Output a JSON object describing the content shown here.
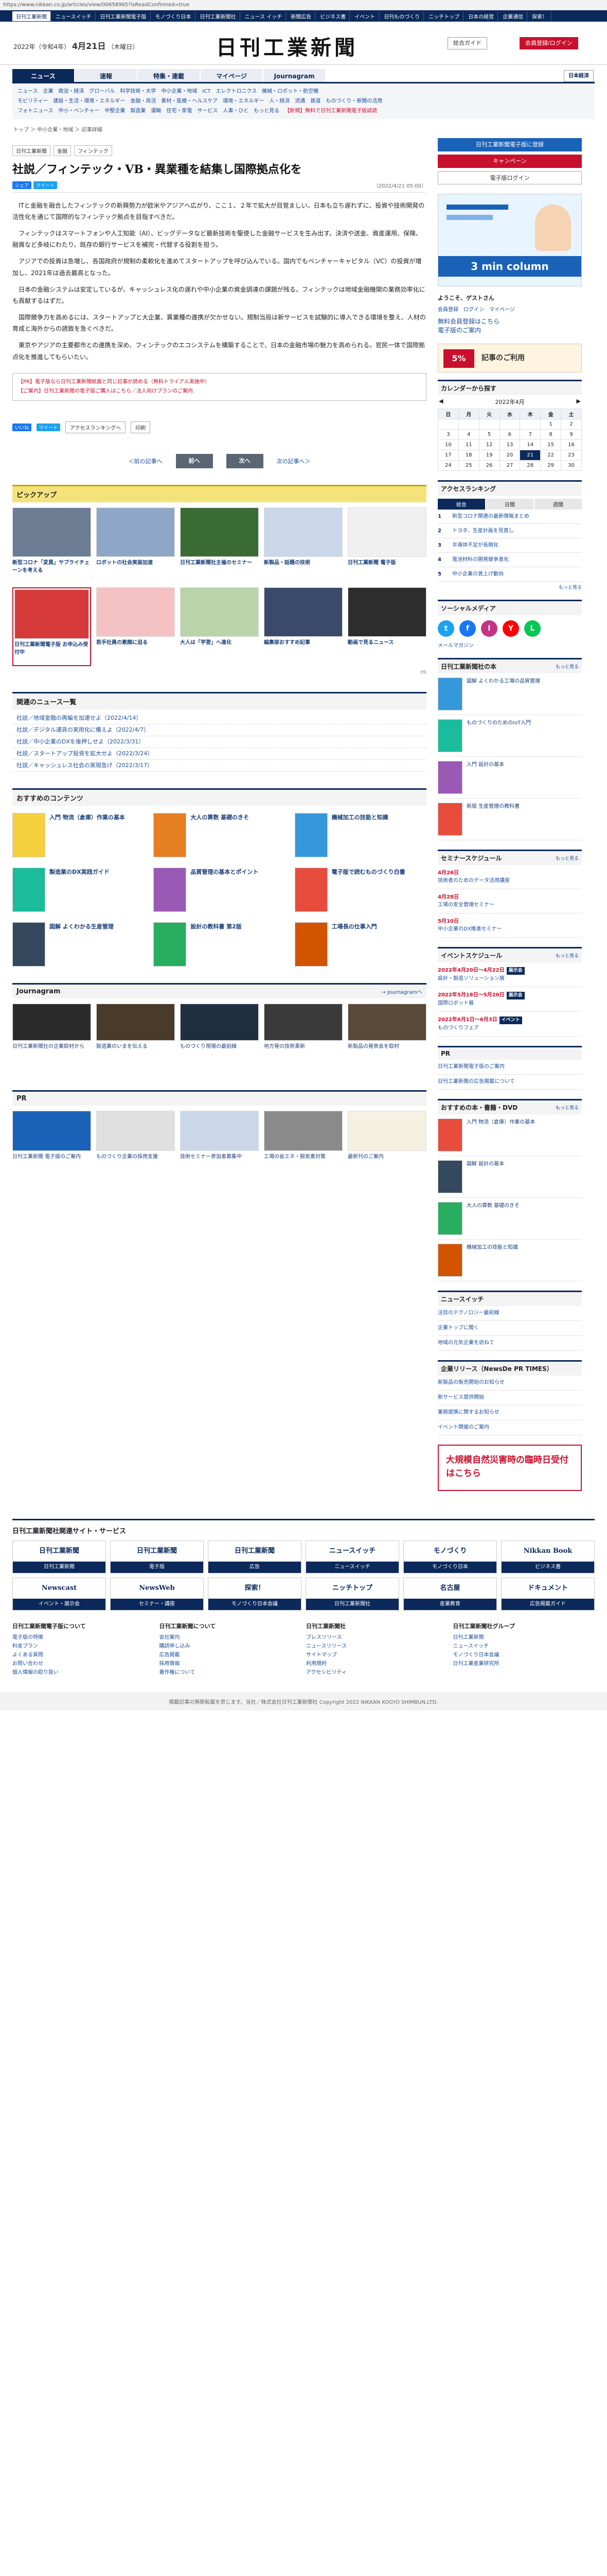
{
  "url": "https://www.nikkan.co.jp/articles/view/00658965?isReadConfirmed=true",
  "topbar": [
    "日刊工業新聞",
    "ニュースイッチ",
    "日刊工業新聞電子版",
    "モノづくり日本",
    "日刊工業新聞社",
    "ニュース イッチ",
    "新聞広告",
    "ビジネス書",
    "イベント",
    "日刊ものづくり",
    "ニッチトップ",
    "日本の経営",
    "企業通信",
    "探索！"
  ],
  "masthead": {
    "date": "2022年（令和4年）",
    "date_md": "4月21日",
    "weekday": "（木曜日）",
    "logo": "日刊工業新聞",
    "guide": "総合ガイド",
    "signup": "会員登録/ログイン"
  },
  "nav": {
    "tabs": [
      "ニュース",
      "速報",
      "特集・連載",
      "マイページ",
      "Journagram"
    ],
    "login": "日本経済"
  },
  "subnav": {
    "rows": [
      [
        "ニュース",
        "企業",
        "政治・経済",
        "グローバル",
        "科学技術・大学",
        "中小企業・地域",
        "ICT",
        "エレクトロニクス",
        "機械・ロボット・航空機"
      ],
      [
        "モビリティー",
        "建設・生活・環境・エネルギー",
        "金融・商況",
        "素材・医療・ヘルスケア",
        "環境・エネルギー",
        "人・経済",
        "流通",
        "鉄道",
        "ものづくり・新聞の活用"
      ],
      [
        "フォトニュース",
        "中小・ベンチャー",
        "中堅企業",
        "製造業",
        "運輸",
        "住宅・家電",
        "サービス",
        "人事・ひと",
        "もっと見る"
      ]
    ],
    "campaign": "【新規】無料で日刊工業新聞電子版試読"
  },
  "breadcrumb": "トップ ＞ 中小企業・地域 ＞ 記事詳細",
  "article": {
    "tags": [
      "日刊工業新聞",
      "金融",
      "フィンテック"
    ],
    "title": "社説／フィンテック・VB・異業種を結集し国際拠点化を",
    "date": "（2022/4/21 05:00）",
    "share": [
      "シェア",
      "ツイート"
    ],
    "body": [
      "ITと金融を融合したフィンテックの新興勢力が欧米やアジアへ広がり、ここ１、２年で拡大が目覚ましい。日本も立ち遅れずに、投資や技術開発の活性化を通じて国際的なフィンテック拠点を目指すべきだ。",
      "フィンテックはスマートフォンや人工知能（AI）、ビッグデータなど最新技術を駆使した金融サービスを生み出す。決済や送金、資産運用、保険、融資など多岐にわたり、既存の銀行サービスを補完・代替する役割を担う。",
      "アジアでの投資は急増し、各国政府が規制の柔軟化を進めてスタートアップを呼び込んでいる。国内でもベンチャーキャピタル（VC）の投資が増加し、2021年は過去最高となった。",
      "日本の金融システムは安定しているが、キャッシュレス化の遅れや中小企業の資金調達の課題が残る。フィンテックは地域金融機関の業務効率化にも貢献するはずだ。",
      "国際競争力を高めるには、スタートアップと大企業、異業種の連携が欠かせない。規制当局は新サービスを試験的に導入できる環境を整え、人材の育成と海外からの誘致を急ぐべきだ。",
      "東京やアジアの主要都市との連携を深め、フィンテックのエコシステムを構築することで、日本の金融市場の魅力を高められる。官民一体で国際拠点化を推進してもらいたい。"
    ],
    "promo": [
      "【PR】電子版なら日刊工業新聞紙面と同じ記事が読める（無料トライアル実施中）",
      "【ご案内】日刊工業新聞の電子版ご購入はこちら／法人向けプランのご案内"
    ],
    "share_actions": [
      "いいね",
      "ツイート",
      "アクセスランキングへ",
      "印刷"
    ]
  },
  "pager": {
    "prev_text": "＜前の記事へ",
    "prev": "前へ",
    "next": "次へ",
    "next_text": "次の記事へ＞"
  },
  "pickup": {
    "title": "ピックアップ",
    "items": [
      "新型コロナ「変異」サプライチェーンを考える",
      "ロボットの社会実装加速",
      "日刊工業新聞社主催のセミナー",
      "新製品・話題の技術",
      "日刊工業新聞 電子版",
      "日刊工業新聞電子版 お申込み受付中",
      "若手社員の素顔に迫る",
      "大人は「学習」へ進化",
      "編集部おすすめ記事",
      "動画で見るニュース"
    ],
    "pr": "PR"
  },
  "news_list": {
    "title": "関連のニュース一覧",
    "items": [
      "社説／地域金融の再編を加速せよ（2022/4/14）",
      "社説／デジタル通貨の実用化に備えよ（2022/4/7）",
      "社説／中小企業のDXを後押しせよ（2022/3/31）",
      "社説／スタートアップ投資を拡大せよ（2022/3/24）",
      "社説／キャッシュレス社会の実現急げ（2022/3/17）"
    ]
  },
  "recommend": {
    "title": "おすすめのコンテンツ",
    "items": [
      "入門 物流（倉庫）作業の基本",
      "大人の算数 基礎のきそ",
      "機械加工の技能と知識",
      "製造業のDX実践ガイド",
      "品質管理の基本とポイント",
      "電子版で読むものづくり白書",
      "図解 よくわかる生産管理",
      "設計の教科書 第2版",
      "工場長の仕事入門"
    ]
  },
  "journagram": {
    "title": "Journagram",
    "more": "→ Journagramへ",
    "items": [
      "日刊工業新聞社の企業取材から",
      "製造業のいまを伝える",
      "ものづくり現場の最前線",
      "地方発の技術革新",
      "新製品の発表会を取材"
    ]
  },
  "pr_section": {
    "title": "PR",
    "items": [
      "日刊工業新聞 電子版のご案内",
      "ものづくり企業の採用支援",
      "技術セミナー参加者募集中",
      "工場の省エネ・脱炭素対策",
      "最新刊のご案内"
    ]
  },
  "sidebar": {
    "buttons": [
      "日刊工業新聞電子版に登録",
      "キャンペーン",
      "電子版ログイン"
    ],
    "ad_title": "3 min column",
    "welcome": "ようこそ、ゲストさん",
    "welcome_links": [
      "会員登録",
      "ログイン",
      "マイページ"
    ],
    "notices": [
      "無料会員登録はこちら",
      "電子版のご案内"
    ],
    "paper_ad": "記事のご利用",
    "calendar": {
      "title": "カレンダーから探す",
      "month": "2022年4月",
      "weekdays": [
        "日",
        "月",
        "火",
        "水",
        "木",
        "金",
        "土"
      ],
      "weeks": [
        [
          "",
          "",
          "",
          "",
          "",
          "1",
          "2"
        ],
        [
          "3",
          "4",
          "5",
          "6",
          "7",
          "8",
          "9"
        ],
        [
          "10",
          "11",
          "12",
          "13",
          "14",
          "15",
          "16"
        ],
        [
          "17",
          "18",
          "19",
          "20",
          "21",
          "22",
          "23"
        ],
        [
          "24",
          "25",
          "26",
          "27",
          "28",
          "29",
          "30"
        ]
      ]
    },
    "ranking": {
      "title": "アクセスランキング",
      "tabs": [
        "総合",
        "日間",
        "週間"
      ],
      "items": [
        "新型コロナ関連の最新情報まとめ",
        "トヨタ、生産計画を見直し",
        "半導体不足が長期化",
        "電池材料の開発競争激化",
        "中小企業の賃上げ動向"
      ]
    },
    "ranking_more": "もっと見る",
    "social_title": "ソーシャルメディア",
    "social": [
      "t",
      "f",
      "I",
      "Y",
      "L"
    ],
    "mail": "メールマガジン",
    "books": {
      "title": "日刊工業新聞社の本",
      "items": [
        "図解 よくわかる工場の品質管理",
        "ものづくりのためのIoT入門",
        "入門 設計の基本",
        "新版 生産管理の教科書"
      ],
      "more": "もっと見る"
    },
    "seminar": {
      "title": "セミナースケジュール",
      "items": [
        {
          "d": "4月26日",
          "t": "技術者のためのデータ活用講座"
        },
        {
          "d": "4月28日",
          "t": "工場の安全管理セミナー"
        },
        {
          "d": "5月10日",
          "t": "中小企業のDX推進セミナー"
        }
      ],
      "more": "もっと見る"
    },
    "events": {
      "title": "イベントスケジュール",
      "items": [
        {
          "d": "2022年4月20日〜4月22日",
          "t": "設計・製造ソリューション展",
          "k": "展示会"
        },
        {
          "d": "2022年5月18日〜5月20日",
          "t": "国際ロボット展",
          "k": "展示会"
        },
        {
          "d": "2022年6月1日〜6月3日",
          "t": "ものづくりフェア",
          "k": "イベント"
        }
      ],
      "more": "もっと見る"
    },
    "pr_title": "PR",
    "pr_items": [
      "日刊工業新聞電子版のご案内",
      "日刊工業新聞の広告掲載について"
    ],
    "bestseller": {
      "title": "おすすめの本・書籍・DVD",
      "items": [
        "入門 物流（倉庫）作業の基本",
        "図解 設計の基本",
        "大人の算数 基礎のきそ",
        "機械加工の技能と知識"
      ],
      "more": "もっと見る"
    },
    "newswitch_title": "ニュースイッチ",
    "newswitch_items": [
      "注目のテクノロジー最前線",
      "企業トップに聞く",
      "地域の元気企業を訪ねて"
    ],
    "press_title": "企業リリース（NewsDe PR TIMES）",
    "press_items": [
      "新製品の販売開始のお知らせ",
      "新サービス提供開始",
      "業務提携に関するお知らせ",
      "イベント開催のご案内"
    ],
    "bottom_ad": "大規模自然災害時の臨時日受付はこちら"
  },
  "footer": {
    "services_title": "日刊工業新聞社関連サイト・サービス",
    "services": [
      {
        "logo": "日刊工業新聞",
        "label": "日刊工業新聞"
      },
      {
        "logo": "日刊工業新聞",
        "label": "電子版"
      },
      {
        "logo": "日刊工業新聞",
        "label": "広告"
      },
      {
        "logo": "ニュースイッチ",
        "label": "ニュースイッチ"
      },
      {
        "logo": "モノづくり",
        "label": "モノづくり日本"
      },
      {
        "logo": "Nikkan Book",
        "label": "ビジネス書"
      },
      {
        "logo": "Newscast",
        "label": "イベント・展示会"
      },
      {
        "logo": "NewsWeb",
        "label": "セミナー・講座"
      },
      {
        "logo": "探索！",
        "label": "モノづくり日本会議"
      },
      {
        "logo": "ニッチトップ",
        "label": "日刊工業新聞社"
      },
      {
        "logo": "名古屋",
        "label": "産業教育"
      },
      {
        "logo": "ドキュメント",
        "label": "広告掲載ガイド"
      }
    ],
    "columns": [
      {
        "title": "日刊工業新聞電子版について",
        "items": [
          "電子版の特徴",
          "料金プラン",
          "よくある質問",
          "お問い合わせ",
          "個人情報の取り扱い"
        ]
      },
      {
        "title": "日刊工業新聞について",
        "items": [
          "会社案内",
          "購読申し込み",
          "広告掲載",
          "採用情報",
          "著作権について"
        ]
      },
      {
        "title": "日刊工業新聞社",
        "items": [
          "プレスリリース",
          "ニュースリリース",
          "サイトマップ",
          "利用規約",
          "アクセシビリティ"
        ]
      },
      {
        "title": "日刊工業新聞社グループ",
        "items": [
          "日刊工業新聞",
          "ニュースイッチ",
          "モノづくり日本会議",
          "日刊工業産業研究所"
        ]
      }
    ],
    "copyright": "掲載記事の無断転載を禁じます。当社／株式会社日刊工業新聞社 Copyright 2022 NIKKAN KOGYO SHIMBUN,LTD."
  },
  "colors": {
    "navy": "#0b2a5b",
    "red": "#c8102e"
  }
}
